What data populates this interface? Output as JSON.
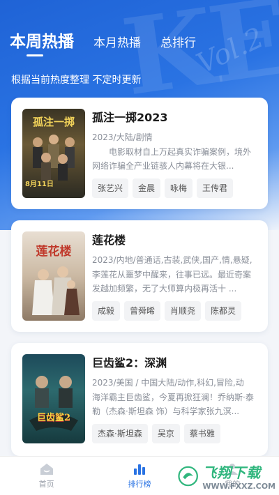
{
  "header": {
    "tabs": [
      "本周热播",
      "本月热播",
      "总排行"
    ],
    "subtitle": "根据当前热度整理 不定时更新"
  },
  "items": [
    {
      "title": "孤注一掷2023",
      "meta": "2023/大陆/剧情",
      "desc": "电影取材自上万起真实诈骗案例，境外网络诈骗全产业链骇人内幕将在大银...",
      "tags": [
        "张艺兴",
        "金晨",
        "咏梅",
        "王传君"
      ],
      "poster_text": "孤注一掷",
      "poster_date": "8月11日"
    },
    {
      "title": "莲花楼",
      "meta": "2023/内地/普通话,古装,武侠,国产,情,悬疑,",
      "desc": "李莲花从噩梦中醒来，往事已远。最近奇案发越加频繁，无了大师算内极再活十 ...",
      "tags": [
        "成毅",
        "曾舜晞",
        "肖顺尧",
        "陈都灵"
      ],
      "poster_text": "莲花楼"
    },
    {
      "title": "巨齿鲨2：深渊",
      "meta": "2023/美国 / 中国大陆/动作,科幻,冒险,动",
      "desc": "海洋霸主巨齿鲨，今夏再掀狂澜！乔纳斯·泰勒（杰森·斯坦森 饰）与科学家张九溟...",
      "tags": [
        "杰森·斯坦森",
        "吴京",
        "蔡书雅"
      ],
      "poster_text": "巨齿鲨2"
    }
  ],
  "nav": {
    "home": "首页",
    "rank": "排行榜",
    "mine": "我的"
  },
  "watermark": {
    "title": "飞翔下载",
    "url": "WWW.FXXZ.COM"
  },
  "colors": {
    "accent": "#2a73e3",
    "hero": "#1f63d6"
  }
}
